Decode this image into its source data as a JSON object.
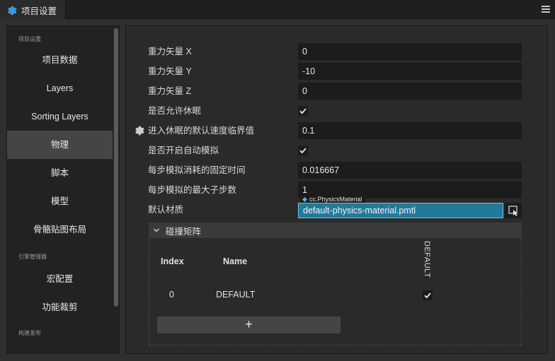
{
  "window": {
    "tab_title": "项目设置",
    "tab_icon": "gear-icon",
    "menu_icon": "hamburger-menu-icon"
  },
  "sidebar": {
    "groups": [
      {
        "label": "项目设置",
        "items": [
          "项目数据",
          "Layers",
          "Sorting Layers",
          "物理",
          "脚本",
          "模型",
          "骨骼贴图布局"
        ]
      },
      {
        "label": "引擎管理器",
        "items": [
          "宏配置",
          "功能裁剪"
        ]
      },
      {
        "label": "构建发布",
        "items": []
      }
    ],
    "active_item": "物理"
  },
  "physics": {
    "gravity_x": {
      "label": "重力矢量 X",
      "value": "0"
    },
    "gravity_y": {
      "label": "重力矢量 Y",
      "value": "-10"
    },
    "gravity_z": {
      "label": "重力矢量 Z",
      "value": "0"
    },
    "allow_sleep": {
      "label": "是否允许休眠",
      "checked": true
    },
    "sleep_threshold": {
      "label": "进入休眠的默认速度临界值",
      "value": "0.1"
    },
    "auto_simulation": {
      "label": "是否开启自动模拟",
      "checked": true
    },
    "fixed_time_step": {
      "label": "每步模拟消耗的固定时间",
      "value": "0.016667"
    },
    "max_sub_steps": {
      "label": "每步模拟的最大子步数",
      "value": "1"
    },
    "default_material": {
      "label": "默认材质",
      "type_tag": "cc.PhysicsMaterial",
      "value": "default-physics-material.pmtl"
    }
  },
  "collision_matrix": {
    "title": "碰撞矩阵",
    "col_index": "Index",
    "col_name": "Name",
    "groups_header": [
      "DEFAULT"
    ],
    "rows": [
      {
        "index": "0",
        "name": "DEFAULT",
        "checked": [
          true
        ]
      }
    ],
    "add_label": "+"
  },
  "colors": {
    "accent": "#3d9ad6",
    "asset_field_bg": "#227a9b",
    "asset_field_border": "#6fc3e0"
  }
}
